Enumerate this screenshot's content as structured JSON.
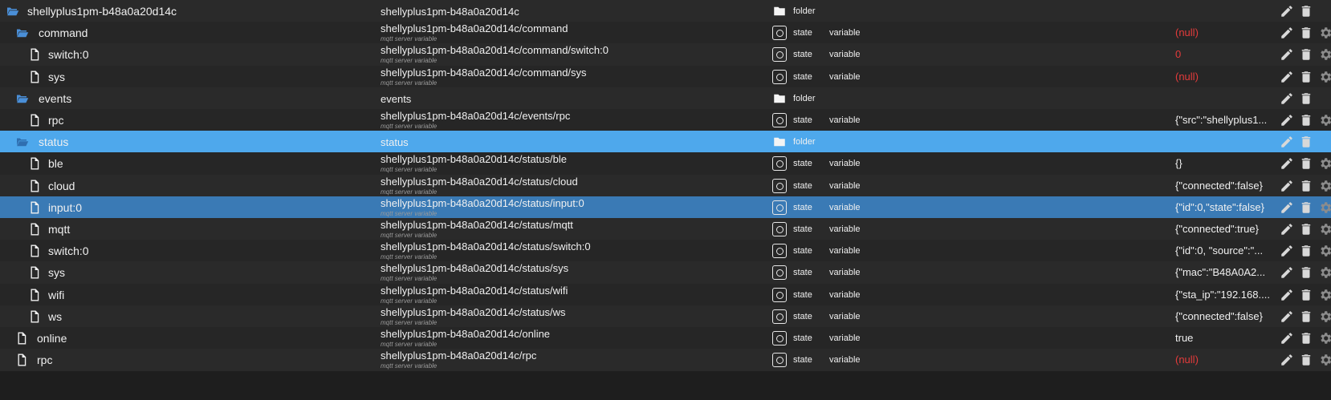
{
  "rows": [
    {
      "name": "shellyplus1pm-b48a0a20d14c",
      "kind": "folder-open",
      "level": 0,
      "id": "shellyplus1pm-b48a0a20d14c",
      "sub": "",
      "type": "folder",
      "role": "",
      "value": "",
      "null": false,
      "sel": ""
    },
    {
      "name": "command",
      "kind": "folder-open",
      "level": 1,
      "id": "shellyplus1pm-b48a0a20d14c/command",
      "sub": "mqtt server variable",
      "type": "state",
      "role": "variable",
      "value": "(null)",
      "null": true,
      "sel": ""
    },
    {
      "name": "switch:0",
      "kind": "file",
      "level": 2,
      "id": "shellyplus1pm-b48a0a20d14c/command/switch:0",
      "sub": "mqtt server variable",
      "type": "state",
      "role": "variable",
      "value": "0",
      "null": true,
      "sel": ""
    },
    {
      "name": "sys",
      "kind": "file",
      "level": 2,
      "id": "shellyplus1pm-b48a0a20d14c/command/sys",
      "sub": "mqtt server variable",
      "type": "state",
      "role": "variable",
      "value": "(null)",
      "null": true,
      "sel": ""
    },
    {
      "name": "events",
      "kind": "folder-open",
      "level": 1,
      "id": "events",
      "sub": "",
      "type": "folder",
      "role": "",
      "value": "",
      "null": false,
      "sel": ""
    },
    {
      "name": "rpc",
      "kind": "file",
      "level": 2,
      "id": "shellyplus1pm-b48a0a20d14c/events/rpc",
      "sub": "mqtt server variable",
      "type": "state",
      "role": "variable",
      "value": "{\"src\":\"shellyplus1...",
      "null": false,
      "sel": ""
    },
    {
      "name": "status",
      "kind": "folder-open",
      "level": 1,
      "id": "status",
      "sub": "",
      "type": "folder",
      "role": "",
      "value": "",
      "null": false,
      "sel": "light"
    },
    {
      "name": "ble",
      "kind": "file",
      "level": 2,
      "id": "shellyplus1pm-b48a0a20d14c/status/ble",
      "sub": "mqtt server variable",
      "type": "state",
      "role": "variable",
      "value": "{}",
      "null": false,
      "sel": ""
    },
    {
      "name": "cloud",
      "kind": "file",
      "level": 2,
      "id": "shellyplus1pm-b48a0a20d14c/status/cloud",
      "sub": "mqtt server variable",
      "type": "state",
      "role": "variable",
      "value": "{\"connected\":false}",
      "null": false,
      "sel": ""
    },
    {
      "name": "input:0",
      "kind": "file",
      "level": 2,
      "id": "shellyplus1pm-b48a0a20d14c/status/input:0",
      "sub": "mqtt server variable",
      "type": "state",
      "role": "variable",
      "value": "{\"id\":0,\"state\":false}",
      "null": false,
      "sel": "dark"
    },
    {
      "name": "mqtt",
      "kind": "file",
      "level": 2,
      "id": "shellyplus1pm-b48a0a20d14c/status/mqtt",
      "sub": "mqtt server variable",
      "type": "state",
      "role": "variable",
      "value": "{\"connected\":true}",
      "null": false,
      "sel": ""
    },
    {
      "name": "switch:0",
      "kind": "file",
      "level": 2,
      "id": "shellyplus1pm-b48a0a20d14c/status/switch:0",
      "sub": "mqtt server variable",
      "type": "state",
      "role": "variable",
      "value": "{\"id\":0, \"source\":\"...",
      "null": false,
      "sel": ""
    },
    {
      "name": "sys",
      "kind": "file",
      "level": 2,
      "id": "shellyplus1pm-b48a0a20d14c/status/sys",
      "sub": "mqtt server variable",
      "type": "state",
      "role": "variable",
      "value": "{\"mac\":\"B48A0A2...",
      "null": false,
      "sel": ""
    },
    {
      "name": "wifi",
      "kind": "file",
      "level": 2,
      "id": "shellyplus1pm-b48a0a20d14c/status/wifi",
      "sub": "mqtt server variable",
      "type": "state",
      "role": "variable",
      "value": "{\"sta_ip\":\"192.168....",
      "null": false,
      "sel": ""
    },
    {
      "name": "ws",
      "kind": "file",
      "level": 2,
      "id": "shellyplus1pm-b48a0a20d14c/status/ws",
      "sub": "mqtt server variable",
      "type": "state",
      "role": "variable",
      "value": "{\"connected\":false}",
      "null": false,
      "sel": ""
    },
    {
      "name": "online",
      "kind": "file",
      "level": 1,
      "id": "shellyplus1pm-b48a0a20d14c/online",
      "sub": "mqtt server variable",
      "type": "state",
      "role": "variable",
      "value": "true",
      "null": false,
      "sel": ""
    },
    {
      "name": "rpc",
      "kind": "file",
      "level": 1,
      "id": "shellyplus1pm-b48a0a20d14c/rpc",
      "sub": "mqtt server variable",
      "type": "state",
      "role": "variable",
      "value": "(null)",
      "null": true,
      "sel": ""
    }
  ],
  "icons": {
    "folder": "folder-icon",
    "file": "file-icon",
    "state": "state-icon",
    "edit": "pencil-icon",
    "delete": "trash-icon",
    "settings": "gear-icon"
  },
  "colors": {
    "null_value": "#e43b3b",
    "selected_light": "#4ea8ec",
    "selected_dark": "#3a7ab5",
    "background": "#2a2a2a"
  }
}
